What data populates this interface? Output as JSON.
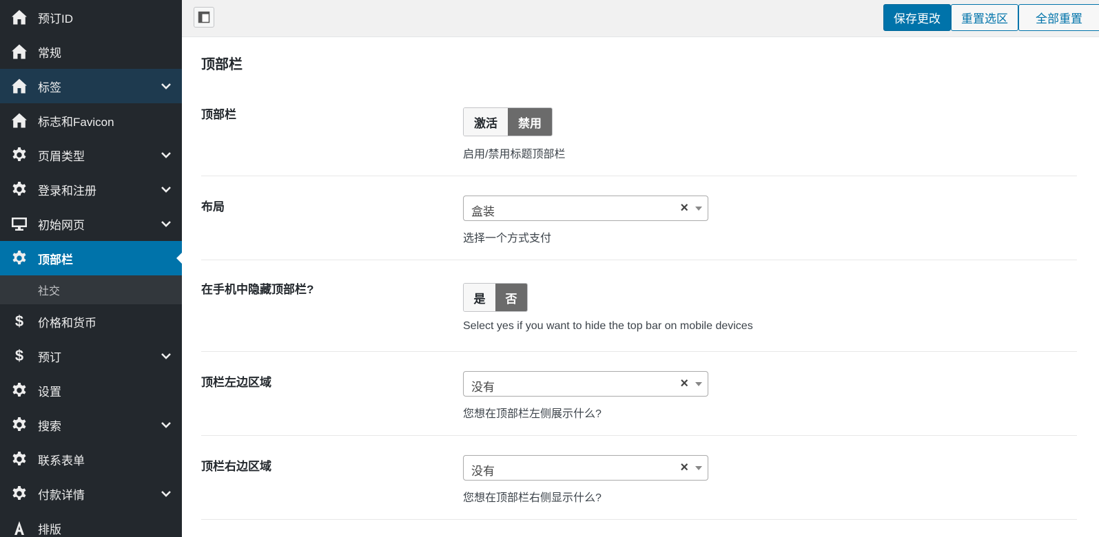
{
  "sidebar": {
    "items": [
      {
        "label": "预订ID",
        "icon": "home-icon"
      },
      {
        "label": "常规",
        "icon": "home-icon"
      },
      {
        "label": "标签",
        "icon": "home-icon"
      },
      {
        "label": "标志和Favicon",
        "icon": "home-icon"
      },
      {
        "label": "页眉类型",
        "icon": "gear-icon"
      },
      {
        "label": "登录和注册",
        "icon": "gear-icon"
      },
      {
        "label": "初始网页",
        "icon": "monitor-icon"
      },
      {
        "label": "顶部栏",
        "icon": "gear-icon"
      },
      {
        "label": "社交"
      },
      {
        "label": "价格和货币",
        "icon": "dollar-icon"
      },
      {
        "label": "预订",
        "icon": "dollar-icon"
      },
      {
        "label": "设置",
        "icon": "gear-icon"
      },
      {
        "label": "搜索",
        "icon": "gear-icon"
      },
      {
        "label": "联系表单",
        "icon": "gear-icon"
      },
      {
        "label": "付款详情",
        "icon": "gear-icon"
      },
      {
        "label": "排版",
        "icon": "typography-icon"
      }
    ],
    "dollar_glyph": "$"
  },
  "toolbar": {
    "save_label": "保存更改",
    "reset_section_label": "重置选区",
    "reset_all_label": "全部重置"
  },
  "main": {
    "section_title": "顶部栏",
    "fields": {
      "topbar": {
        "label": "顶部栏",
        "on_label": "激活",
        "off_label": "禁用",
        "selected": "禁用",
        "desc": "启用/禁用标题顶部栏"
      },
      "layout": {
        "label": "布局",
        "value": "盒装",
        "clear": "×",
        "desc": "选择一个方式支付"
      },
      "hide_mobile": {
        "label": "在手机中隐藏顶部栏?",
        "yes_label": "是",
        "no_label": "否",
        "selected": "否",
        "desc": "Select yes if you want to hide the top bar on mobile devices"
      },
      "left_area": {
        "label": "顶栏左边区域",
        "value": "没有",
        "clear": "×",
        "desc": "您想在顶部栏左侧展示什么?"
      },
      "right_area": {
        "label": "顶栏右边区域",
        "value": "没有",
        "clear": "×",
        "desc": "您想在顶部栏右侧显示什么?"
      }
    }
  },
  "colors": {
    "sidebar_bg": "#23282d",
    "accent": "#0073aa",
    "switch_selected": "#6b6b6b"
  }
}
